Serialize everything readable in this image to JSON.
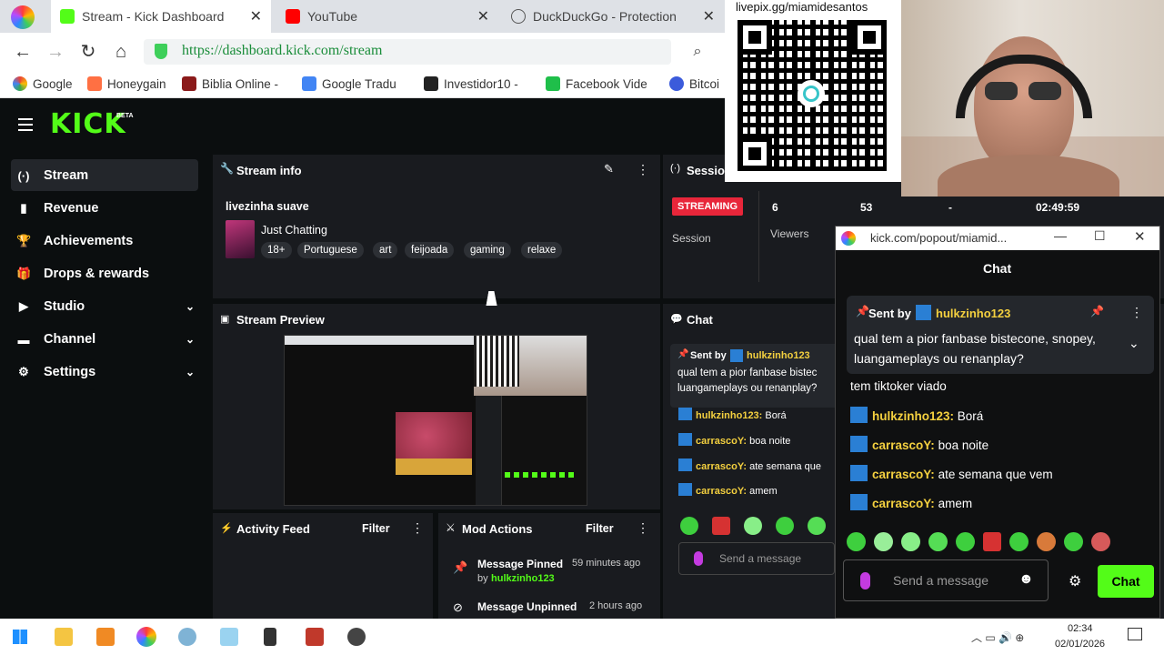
{
  "browser": {
    "tabs": [
      {
        "title": "Stream - Kick Dashboard"
      },
      {
        "title": "YouTube"
      },
      {
        "title": "DuckDuckGo - Protection"
      }
    ],
    "url": "https://dashboard.kick.com/stream",
    "bookmarks": [
      "Google",
      "Honeygain",
      "Biblia Online -",
      "Google Tradu",
      "Investidor10 -",
      "Facebook Vide",
      "Bitcoi"
    ]
  },
  "overlay": {
    "qr_caption": "livepix.gg/miamidesantos",
    "webcam": "streamer webcam"
  },
  "kick": {
    "logo": "KICK",
    "logo_badge": "BETA",
    "sidebar": [
      {
        "label": "Stream",
        "icon": "(·)"
      },
      {
        "label": "Revenue",
        "icon": "▮"
      },
      {
        "label": "Achievements",
        "icon": "🏆"
      },
      {
        "label": "Drops & rewards",
        "icon": "🎁"
      },
      {
        "label": "Studio",
        "icon": "▶"
      },
      {
        "label": "Channel",
        "icon": "▬"
      },
      {
        "label": "Settings",
        "icon": "⚙"
      }
    ],
    "stream_info": {
      "title": "Stream info",
      "stream_title": "livezinha suave",
      "category": "Just Chatting",
      "tags": [
        "18+",
        "Portuguese",
        "art",
        "feijoada",
        "gaming",
        "relaxe"
      ]
    },
    "session": {
      "title": "Sessio",
      "status": "STREAMING",
      "session_label": "Session",
      "viewers": "6",
      "viewers_label": "Viewers",
      "followers": "53",
      "dash": "-",
      "time": "02:49:59"
    },
    "preview_title": "Stream Preview",
    "chat_title": "Chat",
    "chat_pinned_by": "Sent by",
    "chat_pinned_user": "hulkzinho123",
    "chat_pinned_msg": "qual tem a pior fanbase bistec luangameplays ou renanplay?",
    "chat_messages": [
      {
        "user": "hulkzinho123:",
        "text": "Borá"
      },
      {
        "user": "carrascoY:",
        "text": "boa noite"
      },
      {
        "user": "carrascoY:",
        "text": "ate semana que"
      },
      {
        "user": "carrascoY:",
        "text": "amem"
      }
    ],
    "chat_placeholder": "Send a message",
    "activity": {
      "title": "Activity Feed",
      "filter": "Filter"
    },
    "mod_actions": {
      "title": "Mod Actions",
      "filter": "Filter",
      "items": [
        {
          "action": "Message Pinned",
          "by": "by",
          "user": "hulkzinho123",
          "time": "59 minutes ago"
        },
        {
          "action": "Message Unpinned",
          "time": "2 hours ago"
        }
      ]
    }
  },
  "popout": {
    "url": "kick.com/popout/miamid...",
    "title": "Chat",
    "pinned_by": "Sent by",
    "pinned_user": "hulkzinho123",
    "pinned_msg": "qual tem a pior fanbase bistecone, snopey, luangameplays ou renanplay?",
    "partial_msg": "tem tiktoker viado",
    "messages": [
      {
        "user": "hulkzinho123:",
        "text": "Borá"
      },
      {
        "user": "carrascoY:",
        "text": "boa noite"
      },
      {
        "user": "carrascoY:",
        "text": "ate semana que vem"
      },
      {
        "user": "carrascoY:",
        "text": "amem"
      }
    ],
    "placeholder": "Send a message",
    "send": "Chat"
  },
  "taskbar": {
    "time": "02:34",
    "date": "02/01/2026"
  },
  "colors": {
    "kick_green": "#53fc18",
    "streaming_red": "#e8263a",
    "panel_bg": "#191b1f"
  }
}
